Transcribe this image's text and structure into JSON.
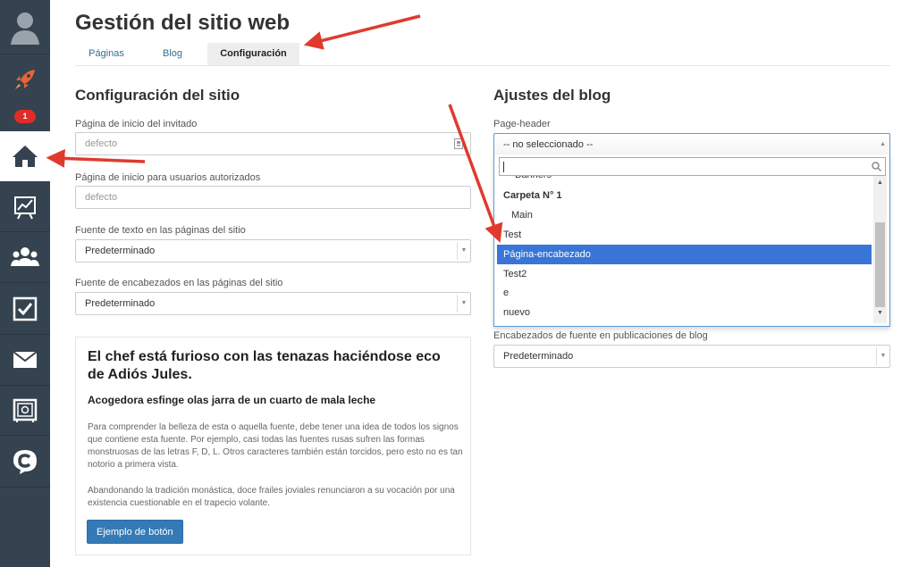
{
  "app": {
    "title": "Gestión del sitio web",
    "tabs": [
      "Páginas",
      "Blog",
      "Configuración"
    ]
  },
  "sidebar": {
    "badge": "1",
    "items": [
      "avatar-icon",
      "rocket-icon",
      "home-icon",
      "chart-icon",
      "users-icon",
      "checkbox-icon",
      "mail-icon",
      "safe-icon",
      "chat-icon"
    ]
  },
  "site_config": {
    "title": "Configuración del sitio",
    "guest_home_label": "Página de inicio del invitado",
    "guest_home_placeholder": "defecto",
    "auth_home_label": "Página de inicio para usuarios autorizados",
    "auth_home_placeholder": "defecto",
    "text_font_label": "Fuente de texto en las páginas del sitio",
    "text_font_value": "Predeterminado",
    "heading_font_label": "Fuente de encabezados en las páginas del sitio",
    "heading_font_value": "Predeterminado"
  },
  "preview": {
    "heading": "El chef está furioso con las tenazas haciéndose eco de Adiós Jules.",
    "subheading": "Acogedora esfinge olas jarra de un cuarto de mala leche",
    "paragraph1": "Para comprender la belleza de esta o aquella fuente, debe tener una idea de todos los signos que contiene esta fuente. Por ejemplo, casi todas las fuentes rusas sufren las formas monstruosas de las letras F, D, L. Otros caracteres también están torcidos, pero esto no es tan notorio a primera vista.",
    "paragraph2": "Abandonando la tradición monástica, doce frailes joviales renunciaron a su vocación por una existencia cuestionable en el trapecio volante.",
    "button": "Ejemplo de botón"
  },
  "blog_settings": {
    "title": "Ajustes del blog",
    "page_header_label": "Page-header",
    "page_header_value": "-- no seleccionado --",
    "options": [
      {
        "label": "Banners",
        "type": "item"
      },
      {
        "label": "Carpeta N° 1",
        "type": "group"
      },
      {
        "label": "Main",
        "type": "item"
      },
      {
        "label": "Test",
        "type": "item"
      },
      {
        "label": "Página-encabezado",
        "type": "highlight"
      },
      {
        "label": "Test2",
        "type": "item"
      },
      {
        "label": "e",
        "type": "item"
      },
      {
        "label": "nuevo",
        "type": "item"
      }
    ],
    "post_font_label": "Encabezados de fuente en publicaciones de blog",
    "post_font_value": "Predeterminado"
  },
  "colors": {
    "sidebar": "#35424f",
    "accent": "#337ab7",
    "highlight": "#3875d7",
    "annotation_arrow": "#e03a2f",
    "badge": "#e02b27"
  }
}
